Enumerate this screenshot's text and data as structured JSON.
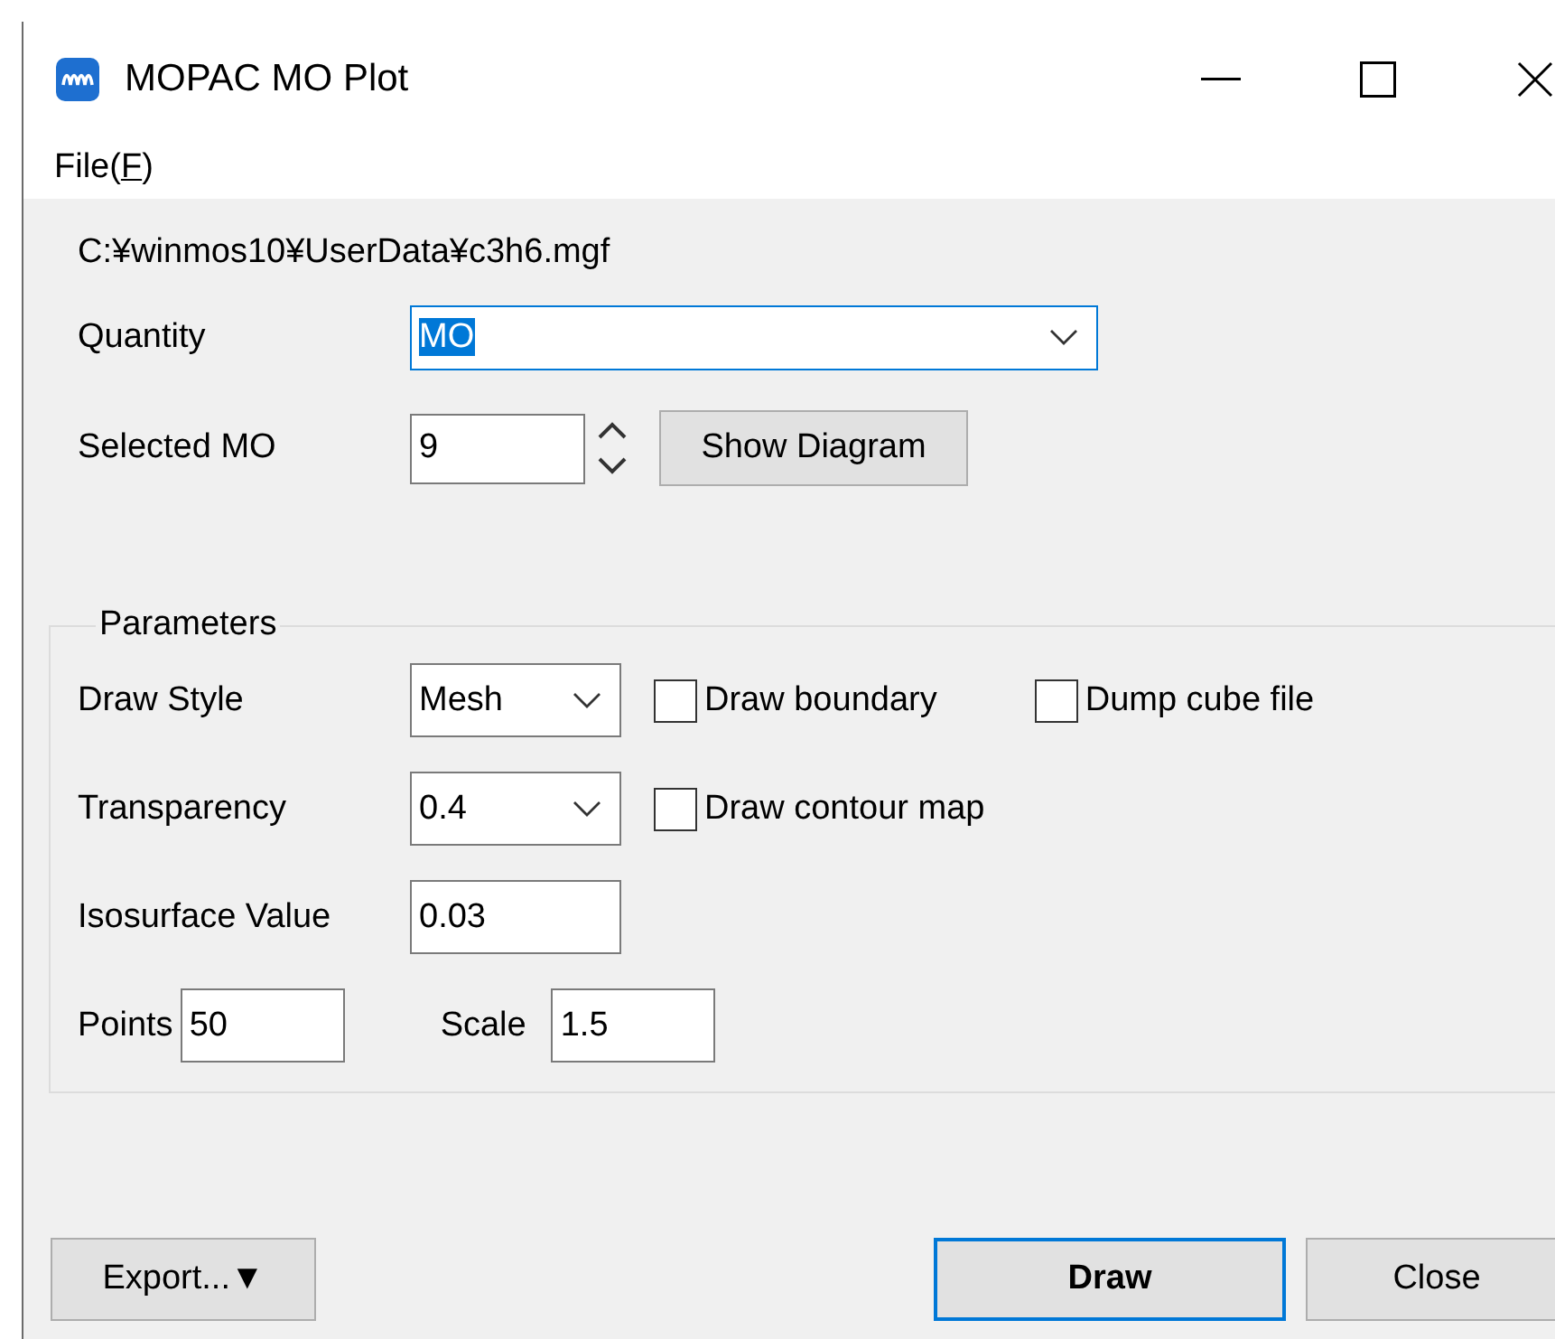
{
  "window": {
    "title": "MOPAC MO Plot"
  },
  "menu": [
    {
      "before": "File(",
      "accelerator": "F",
      "after": ")"
    }
  ],
  "file_path": "C:¥winmos10¥UserData¥c3h6.mgf",
  "quantity": {
    "label": "Quantity",
    "value": "MO",
    "text_selected": true
  },
  "selected_mo": {
    "label": "Selected MO",
    "value": "9",
    "button": "Show Diagram"
  },
  "parameters": {
    "title": "Parameters",
    "rows": [
      {
        "kind": "select",
        "label": "Draw Style",
        "value": "Mesh",
        "checkboxes": [
          {
            "label": "Draw boundary",
            "checked": false
          },
          {
            "label": "Dump cube file",
            "checked": false
          }
        ]
      },
      {
        "kind": "select",
        "label": "Transparency",
        "value": "0.4",
        "checkboxes": [
          {
            "label": "Draw contour map",
            "checked": false
          }
        ]
      },
      {
        "kind": "input",
        "label": "Isosurface Value",
        "value": "0.03"
      },
      {
        "kind": "pair",
        "fields": [
          {
            "label": "Points",
            "value": "50"
          },
          {
            "label": "Scale",
            "value": "1.5"
          }
        ]
      }
    ]
  },
  "buttons": [
    {
      "kind": "menu",
      "label": "Export...▼",
      "default": false
    },
    {
      "kind": "push",
      "label": "Draw",
      "default": true
    },
    {
      "kind": "push",
      "label": "Close",
      "default": false
    }
  ]
}
